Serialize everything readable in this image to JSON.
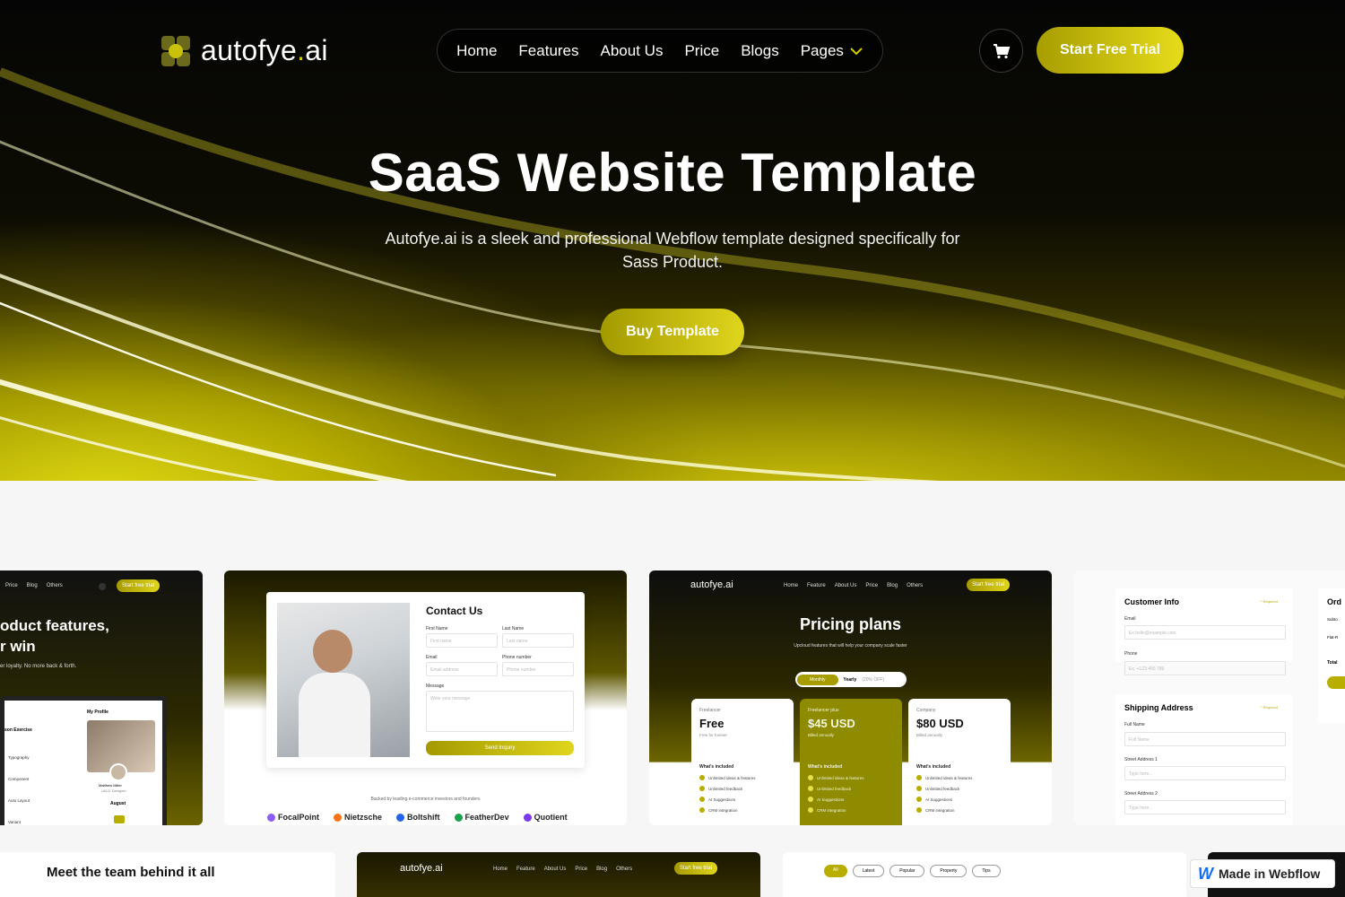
{
  "brand": {
    "name_main": "autofye",
    "name_dot": ".",
    "name_tld": "ai"
  },
  "nav": {
    "items": [
      {
        "label": "Home"
      },
      {
        "label": "Features"
      },
      {
        "label": "About Us"
      },
      {
        "label": "Price"
      },
      {
        "label": "Blogs"
      },
      {
        "label": "Pages"
      }
    ]
  },
  "header": {
    "cta_label": "Start Free Trial"
  },
  "hero": {
    "title": "SaaS Website Template",
    "subtitle": "Autofye.ai is a sleek and professional Webflow template designed specifically for Sass Product.",
    "button_label": "Buy Template"
  },
  "colors": {
    "accent": "#d6cc00",
    "accent_dark": "#a39a00",
    "hero_bg": "#050505",
    "section_bg": "#f6f6f6"
  },
  "previews": {
    "features": {
      "heading_1": "oduct features,",
      "heading_2": "r win",
      "body": "er loyalty. No more back & forth.",
      "mini_nav": [
        "Price",
        "Blog",
        "Others"
      ],
      "button": "Start free trial",
      "profile_title": "My Profile",
      "list_title": "son Exercise",
      "list": [
        "Typography",
        "Component",
        "Auto Layout",
        "Variant"
      ],
      "person_name": "Matthew Miller",
      "person_role": "UI/UX Designer",
      "calendar_month": "August"
    },
    "contact": {
      "title": "Contact Us",
      "first_name": "First Name",
      "last_name": "Last Name",
      "email": "Email",
      "phone": "Phone number",
      "message": "Message",
      "first_ph": "First name",
      "last_ph": "Last name",
      "email_ph": "Email address",
      "phone_ph": "Phone number",
      "message_ph": "Write your message",
      "button": "Send Inquiry",
      "backed": "Backed by leading e-commerce investors and founders",
      "logos": [
        "FocalPoint",
        "Nietzsche",
        "Boltshift",
        "FeatherDev",
        "Quotient"
      ]
    },
    "pricing": {
      "brand": "autofye.ai",
      "mini_nav": [
        "Home",
        "Feature",
        "About Us",
        "Price",
        "Blog",
        "Others"
      ],
      "button": "Start free trial",
      "title": "Pricing plans",
      "subtitle": "Upcloud features that will help your company scale faster",
      "toggle_monthly": "Monthly",
      "toggle_yearly": "Yearly",
      "toggle_discount": "(20% OFF)",
      "plans": [
        {
          "tier": "Freelancer",
          "name": "Free",
          "sub": "Free for forever"
        },
        {
          "tier": "Freelancer plus",
          "name": "$45 USD",
          "sub": "Billed annually"
        },
        {
          "tier": "Company",
          "name": "$80 USD",
          "sub": "Billed annually"
        }
      ],
      "included": "What's included",
      "features": [
        "Unlimited ideas & features",
        "Unlimited feedback",
        "AI Suggestions",
        "CRM integration"
      ]
    },
    "checkout": {
      "customer_info": "Customer Info",
      "required": "* Required",
      "email": "Email",
      "email_ph": "Ex.hello@example.com",
      "phone": "Phone",
      "phone_ph": "Ex. +123 456 789",
      "shipping": "Shipping Address",
      "full_name": "Full Name",
      "full_name_ph": "Full Name",
      "street1": "Street Address 1",
      "street2": "Street Address 2",
      "type_ph": "Type here...",
      "order": "Ord",
      "subtotal": "Subto",
      "flat": "Flat-R",
      "total": "Total"
    },
    "team": {
      "title": "Meet the team behind it all"
    },
    "blog": {
      "filters": [
        "All",
        "Latest",
        "Popular",
        "Property",
        "Tips"
      ]
    }
  },
  "badge": {
    "label": "Made in Webflow"
  }
}
